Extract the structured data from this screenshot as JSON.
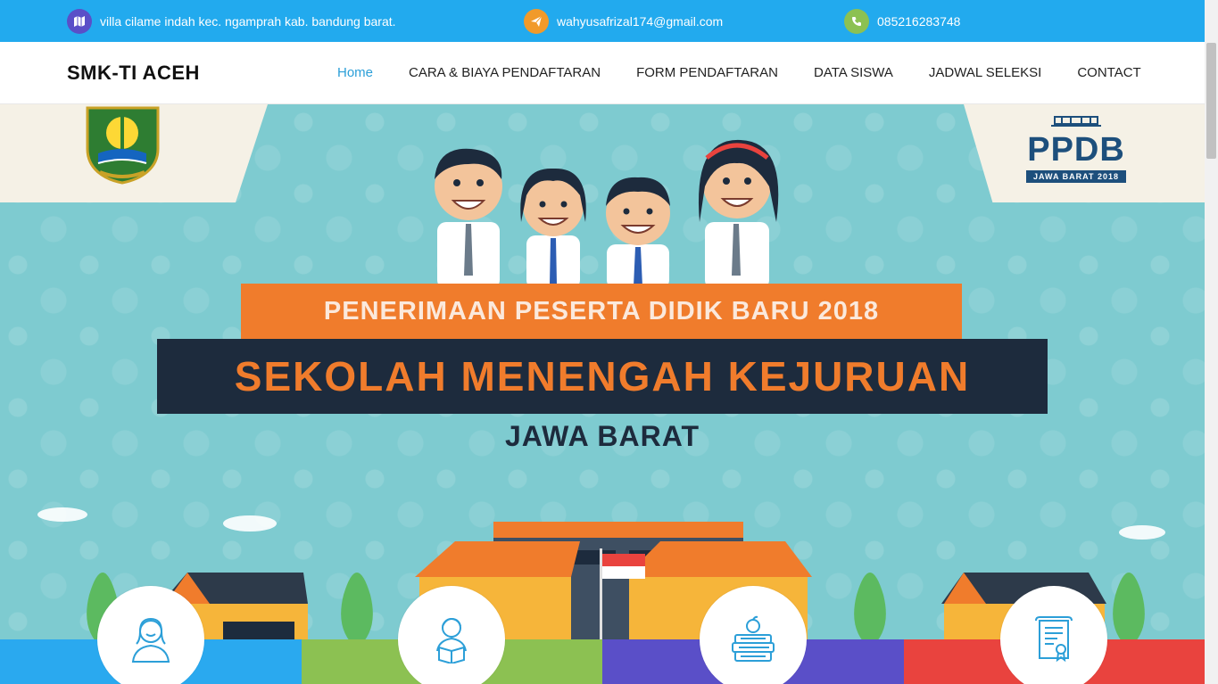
{
  "topbar": {
    "address": "villa cilame indah kec. ngamprah kab. bandung barat.",
    "email": "wahyusafrizal174@gmail.com",
    "phone": "085216283748",
    "icons": [
      "map-icon",
      "send-icon",
      "phone-icon"
    ]
  },
  "navbar": {
    "brand": "SMK-TI ACEH",
    "menu": [
      {
        "label": "Home",
        "active": true
      },
      {
        "label": "CARA & BIAYA PENDAFTARAN",
        "active": false
      },
      {
        "label": "FORM PENDAFTARAN",
        "active": false
      },
      {
        "label": "DATA SISWA",
        "active": false
      },
      {
        "label": "JADWAL SELEKSI",
        "active": false
      },
      {
        "label": "CONTACT",
        "active": false
      }
    ]
  },
  "hero": {
    "logo_text": "PPDB",
    "logo_sub": "JAWA BARAT 2018",
    "line1": "PENERIMAAN PESERTA DIDIK BARU 2018",
    "line2": "SEKOLAH MENENGAH KEJURUAN",
    "line3": "JAWA BARAT"
  },
  "features": {
    "icons": [
      "student-girl-icon",
      "student-reading-icon",
      "books-apple-icon",
      "certificate-icon"
    ]
  },
  "colors": {
    "topbar": "#22aaee",
    "active_link": "#2c9fd8",
    "blue": "#2aa9ef",
    "green": "#8cc152",
    "purple": "#5a4fc8",
    "red": "#e9433e",
    "orange": "#f07c2c",
    "navy": "#1d2b3d"
  }
}
